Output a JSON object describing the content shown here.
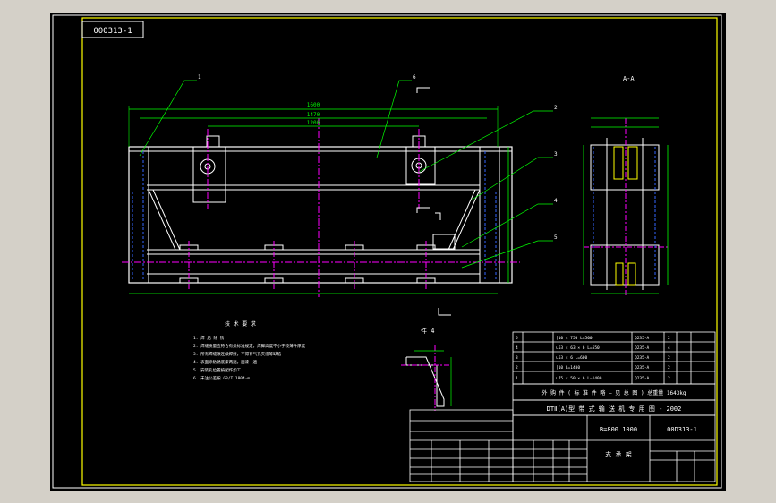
{
  "drawing": {
    "stamp_code": "000313-1",
    "section_label": "A-A",
    "detail_label": "件 4",
    "leaders": [
      "1",
      "2",
      "3",
      "4",
      "5",
      "6"
    ],
    "dims_top": [
      "1600",
      "1470",
      "1200"
    ],
    "notes_title": "技 术 要 求",
    "notes": [
      "1. 焊 后 除 锈",
      "2. 焊缝质量应符合有关标准规定，焊脚高度不小于较薄件厚度",
      "3. 所有焊缝须连续焊接，不得有气孔夹渣等缺陷",
      "4. 表面涂防锈底漆两遍，面漆一遍",
      "5. 安装孔位置按配作加工",
      "6. 未注公差按 GB/T 1804-m"
    ]
  },
  "parts_list": {
    "rows": [
      {
        "no": "5",
        "spec": "[10 × 750 L=500",
        "qty": "2",
        "mat": "Q235-A"
      },
      {
        "no": "4",
        "spec": "∟63 × 63 × 6 L=550",
        "qty": "4",
        "mat": "Q235-A"
      },
      {
        "no": "3",
        "spec": "∟63 × 6 L=600",
        "qty": "2",
        "mat": "Q235-A"
      },
      {
        "no": "2",
        "spec": "[10 L=1400",
        "qty": "2",
        "mat": "Q235-A"
      },
      {
        "no": "1",
        "spec": "∟75 × 50 × 6 L=1400",
        "qty": "2",
        "mat": "Q235-A"
      }
    ]
  },
  "title_block": {
    "header": "外 购 件  ( 标 准 件 略 — 见 总 图 )  总重量  1643kg",
    "title": "DTⅡ(A)型  带 式 输 送 机 专 用 图 - 2002",
    "spec": "B=800 1000",
    "drawing_no": "00D313-1",
    "name": "支 承 架"
  },
  "colors": {
    "border": "#ffff00",
    "outline": "#ffffff",
    "dimension": "#00ff00",
    "centerline": "#ff00ff",
    "hidden": "#3366ff",
    "leader": "#00ff00"
  }
}
